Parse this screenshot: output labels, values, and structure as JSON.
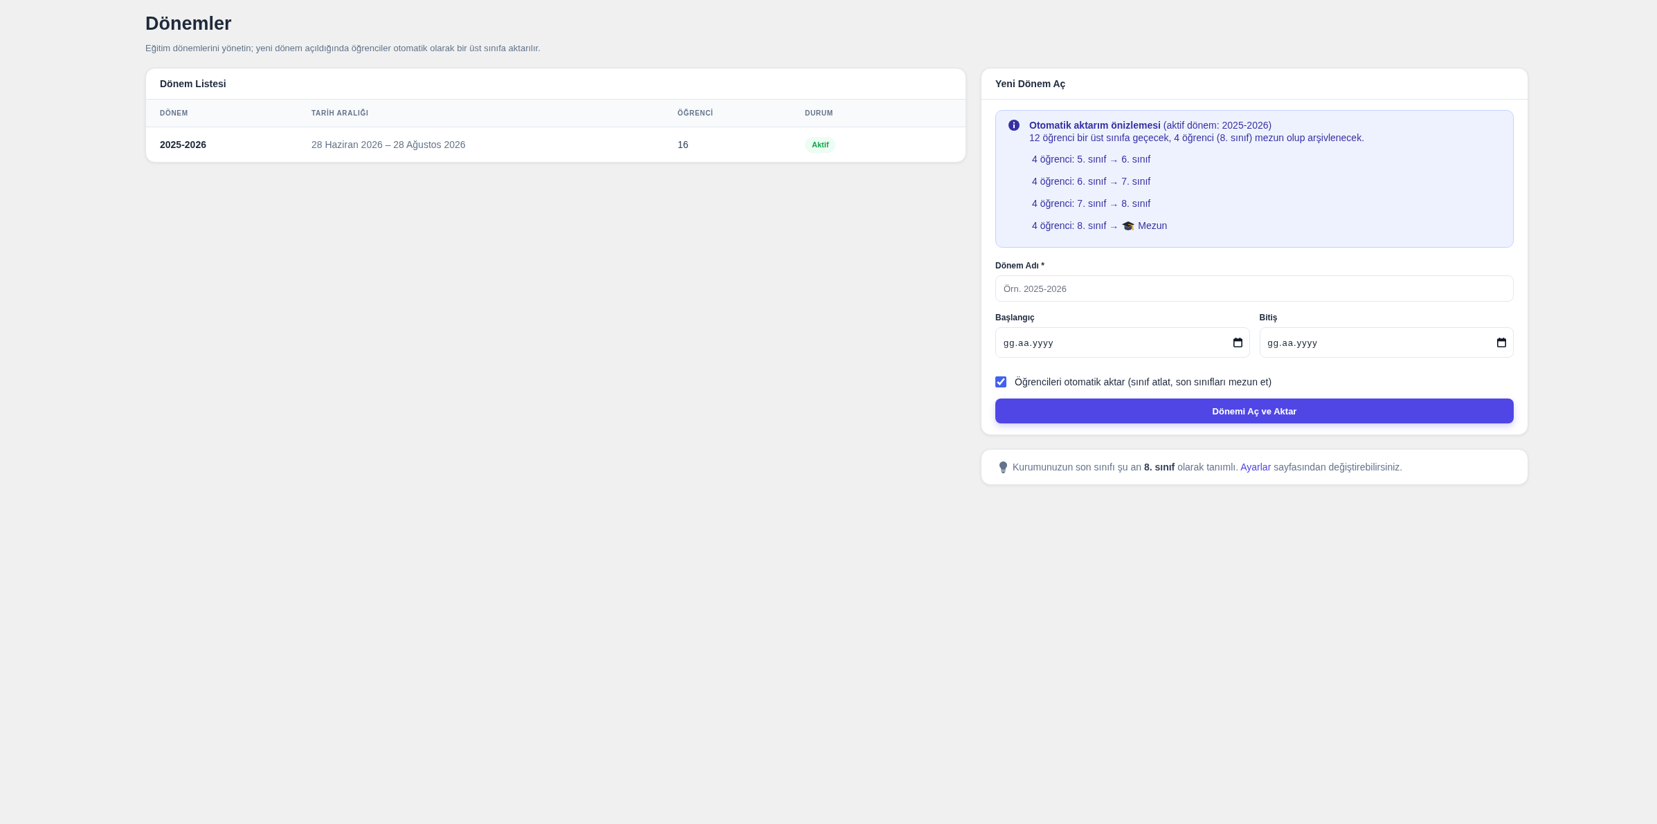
{
  "page": {
    "title": "Dönemler",
    "subtitle": "Eğitim dönemlerini yönetin; yeni dönem açıldığında öğrenciler otomatik olarak bir üst sınıfa aktarılır."
  },
  "period_list": {
    "title": "Dönem Listesi",
    "columns": [
      "DÖNEM",
      "TARİH ARALIĞI",
      "ÖĞRENCİ",
      "DURUM"
    ],
    "rows": [
      {
        "period": "2025-2026",
        "date_range": "28 Haziran 2026 – 28 Ağustos 2026",
        "students": "16",
        "status": {
          "label": "Aktif",
          "kind": "active"
        }
      }
    ]
  },
  "new_period": {
    "title": "Yeni Dönem Aç",
    "preview": {
      "heading": "**Otomatik aktarım önizlemesi** (aktif dönem: 2025-2026)",
      "summary": "12 öğrenci bir üst sınıfa geçecek, 4 öğrenci (8. sınıf) mezun olup arşivlenecek.",
      "transfers": [
        {
          "kind": "promote",
          "text": "4 öğrenci: 5. sınıf → 6. sınıf"
        },
        {
          "kind": "promote",
          "text": "4 öğrenci: 6. sınıf → 7. sınıf"
        },
        {
          "kind": "promote",
          "text": "4 öğrenci: 7. sınıf → 8. sınıf"
        },
        {
          "kind": "graduate",
          "text": "4 öğrenci: 8. sınıf →",
          "target": "Mezun"
        }
      ]
    },
    "name_field": {
      "label": "Dönem Adı *",
      "placeholder": "Örn. 2025-2026"
    },
    "date_fields": [
      {
        "label": "Başlangıç",
        "placeholder": "gg.aa.yyyy"
      },
      {
        "label": "Bitiş",
        "placeholder": "gg.aa.yyyy"
      }
    ],
    "auto_transfer": {
      "label": "Öğrencileri otomatik aktar (sınıf atlat, son sınıfları mezun et)",
      "checked": true
    },
    "submit_button": "Dönemi Aç ve Aktar"
  },
  "tip": {
    "text": "Kurumunuzun son sınıfı şu an **8. sınıf** olarak tanımlı.",
    "link": "Ayarlar",
    "text_after": "sayfasından değiştirebilirsiniz."
  }
}
